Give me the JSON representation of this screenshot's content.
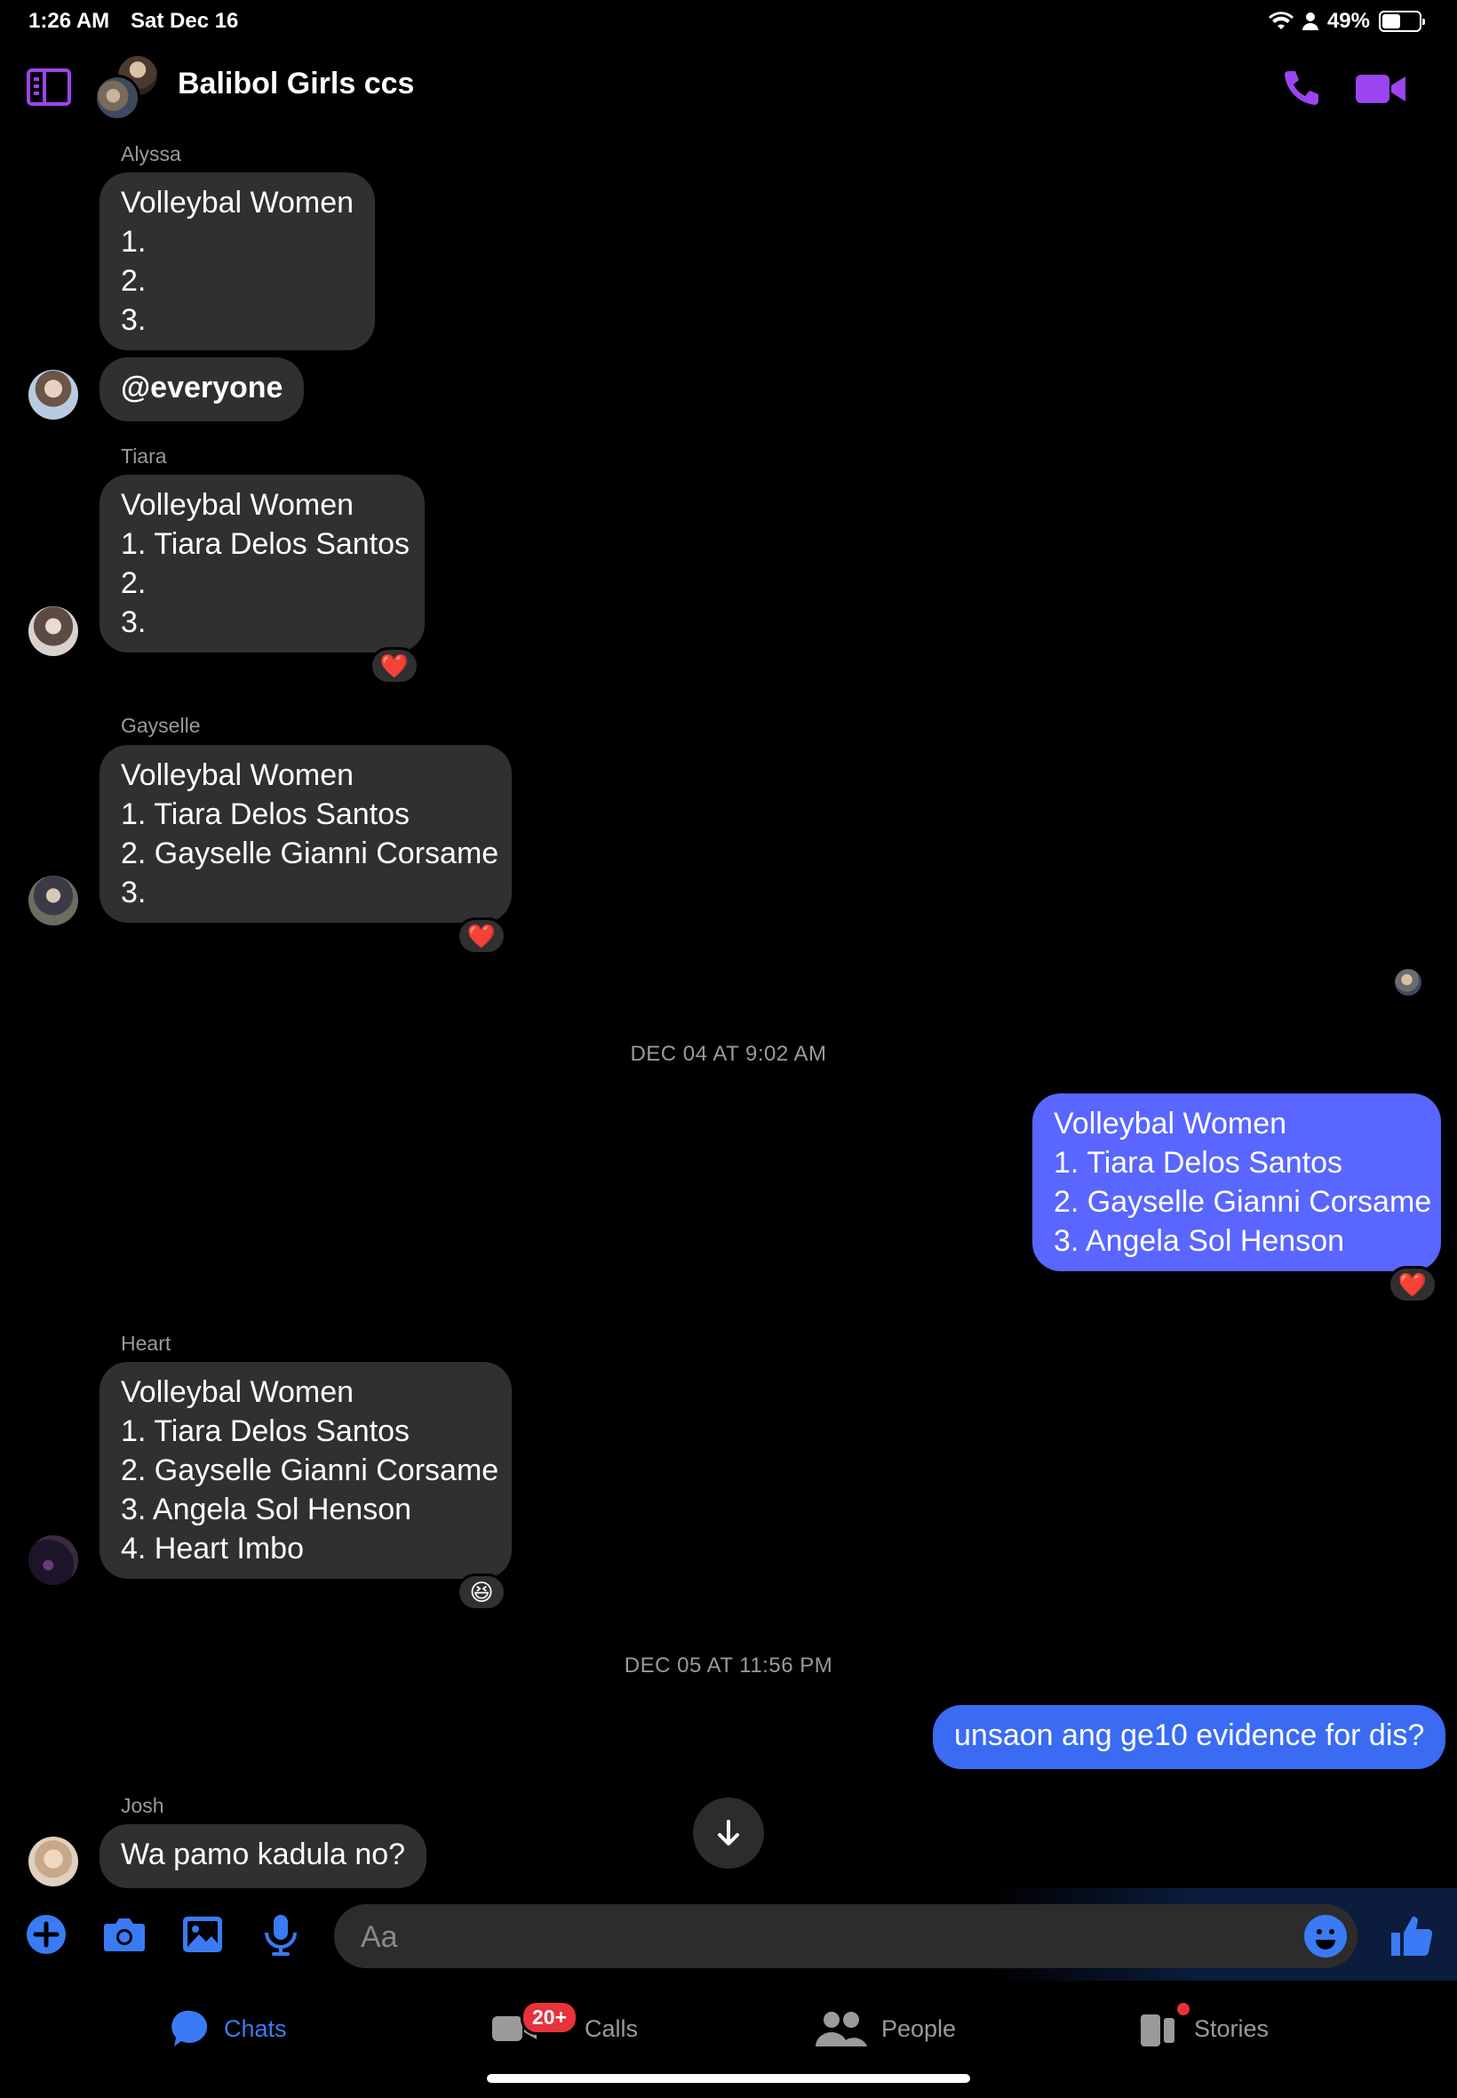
{
  "status_bar": {
    "time": "1:26 AM",
    "date": "Sat Dec 16",
    "battery": "49%",
    "battery_level": 0.49
  },
  "header": {
    "title": "Balibol Girls ccs"
  },
  "messages": [
    {
      "sender": "Alyssa",
      "lines": [
        "Volleybal Women",
        "1.",
        "2.",
        "3."
      ],
      "mention": "@everyone"
    },
    {
      "sender": "Tiara",
      "lines": [
        "Volleybal Women",
        "1. Tiara Delos Santos",
        "2.",
        "3."
      ],
      "reaction": "❤️"
    },
    {
      "sender": "Gayselle",
      "lines": [
        "Volleybal Women",
        "1. Tiara Delos Santos",
        "2. Gayselle Gianni Corsame",
        "3."
      ],
      "reaction": "❤️"
    },
    {
      "sender": "",
      "lines": [
        "Volleybal Women",
        "1. Tiara Delos Santos",
        "2. Gayselle Gianni Corsame",
        "3. Angela Sol Henson"
      ],
      "reaction": "❤️"
    },
    {
      "sender": "Heart",
      "lines": [
        "Volleybal Women",
        "1. Tiara Delos Santos",
        "2. Gayselle Gianni Corsame",
        "3. Angela Sol Henson",
        "4. Heart Imbo"
      ],
      "reaction": "😆"
    },
    {
      "sender": "",
      "lines": [
        "unsaon ang ge10 evidence for dis?"
      ]
    },
    {
      "sender": "Josh",
      "lines": [
        "Wa pamo kadula no?"
      ]
    }
  ],
  "timestamps": [
    "DEC 04 AT 9:02 AM",
    "DEC 05 AT 11:56 PM"
  ],
  "composer": {
    "placeholder": "Aa"
  },
  "tabs": [
    {
      "label": "Chats",
      "icon": "chat-bubble-icon",
      "active": true
    },
    {
      "label": "Calls",
      "icon": "video-call-icon",
      "badge": "20+"
    },
    {
      "label": "People",
      "icon": "people-icon"
    },
    {
      "label": "Stories",
      "icon": "stories-icon"
    }
  ],
  "colors": {
    "accent": "#9b45f0",
    "outgoing": "#5966ff",
    "outgoing_alt": "#3a6bf2",
    "tab_active": "#3a7bf5",
    "incoming": "#303030"
  }
}
